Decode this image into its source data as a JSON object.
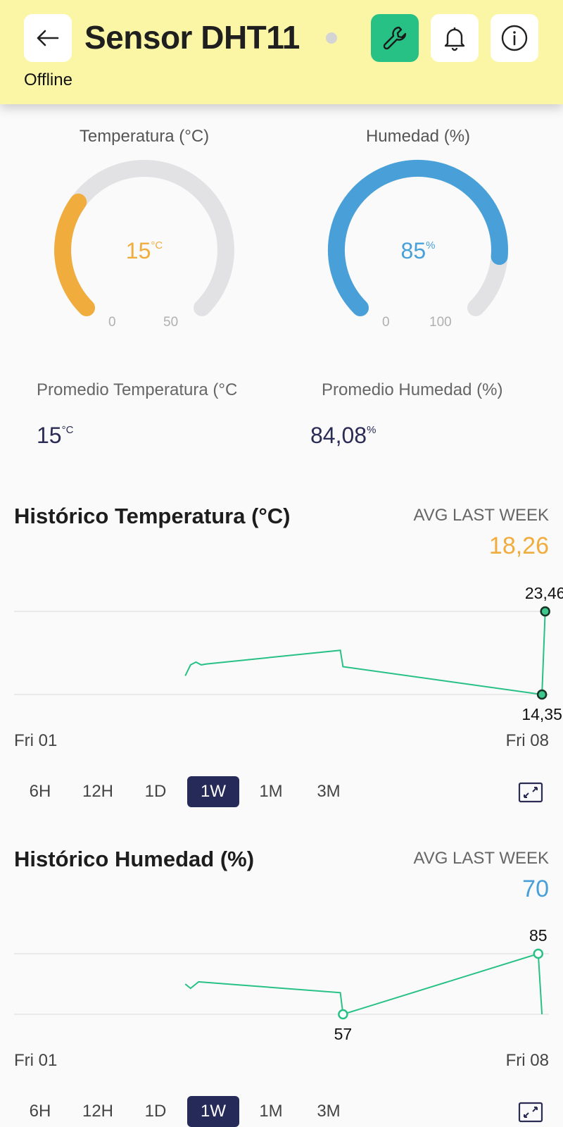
{
  "header": {
    "title": "Sensor DHT11",
    "status": "Offline",
    "colors": {
      "background": "#fbf6a6",
      "wrench_button": "#27c185",
      "status_dot": "#d4d4d4"
    },
    "icons": [
      "back-arrow-icon",
      "wrench-icon",
      "bell-icon",
      "info-icon"
    ]
  },
  "gauges": [
    {
      "label": "Temperatura (°C)",
      "value": "15",
      "unit": "°C",
      "min": "0",
      "max": "50",
      "fill_fraction": 0.3,
      "color": "#f0ad3e"
    },
    {
      "label": "Humedad (%)",
      "value": "85",
      "unit": "%",
      "min": "0",
      "max": "100",
      "fill_fraction": 0.85,
      "color": "#49a0d8"
    }
  ],
  "averages": [
    {
      "label": "Promedio Temperatura (°C",
      "value": "15",
      "unit": "°C"
    },
    {
      "label": "Promedio Humedad (%)",
      "value": "84,08",
      "unit": "%"
    }
  ],
  "charts": [
    {
      "title": "Histórico Temperatura (°C)",
      "avg_label": "AVG LAST WEEK",
      "avg_value": "18,26",
      "avg_color": "#f0ad3e",
      "start_label": "Fri 01",
      "end_label": "Fri 08",
      "max_label": "23,46",
      "min_label": "14,35",
      "active_range": "1W"
    },
    {
      "title": "Histórico Humedad (%)",
      "avg_label": "AVG LAST WEEK",
      "avg_value": "70",
      "avg_color": "#49a0d8",
      "start_label": "Fri 01",
      "end_label": "Fri 08",
      "max_label": "85",
      "min_label": "57",
      "active_range": "1W"
    }
  ],
  "ranges": [
    "6H",
    "12H",
    "1D",
    "1W",
    "1M",
    "3M"
  ],
  "chart_data": [
    {
      "type": "line",
      "x_start": "Fri 01",
      "x_end": "Fri 08",
      "ylim": [
        14.35,
        23.46
      ],
      "grid": true,
      "color": "#27c185",
      "x": [
        0.32,
        0.33,
        0.34,
        0.35,
        0.36,
        0.61,
        0.615,
        0.987,
        0.993
      ],
      "values": [
        16.4,
        17.6,
        17.9,
        17.6,
        17.7,
        19.2,
        17.4,
        14.35,
        23.46
      ]
    },
    {
      "type": "line",
      "x_start": "Fri 01",
      "x_end": "Fri 08",
      "ylim": [
        57,
        85
      ],
      "grid": true,
      "color": "#27c185",
      "x": [
        0.32,
        0.33,
        0.34,
        0.345,
        0.61,
        0.615,
        0.98,
        0.987
      ],
      "values": [
        71,
        69,
        71,
        72,
        67,
        57,
        85,
        57
      ]
    }
  ]
}
